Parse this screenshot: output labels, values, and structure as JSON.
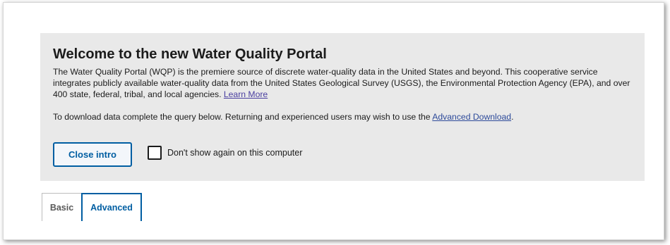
{
  "intro": {
    "title": "Welcome to the new Water Quality Portal",
    "body_text": "The Water Quality Portal (WQP) is the premiere source of discrete water-quality data in the United States and beyond. This cooperative service integrates publicly available water-quality data from the United States Geological Survey (USGS), the Environmental Protection Agency (EPA), and over 400 state, federal, tribal, and local agencies.",
    "learn_more_label": "Learn More",
    "query_text": "To download data complete the query below. Returning and experienced users may wish to use the",
    "advanced_download_label": "Advanced Download",
    "query_end": ".",
    "close_button_label": "Close intro",
    "dont_show_label": "Don't show again on this computer",
    "dont_show_checked": false
  },
  "tabs": [
    {
      "label": "Basic",
      "active": false
    },
    {
      "label": "Advanced",
      "active": true
    }
  ],
  "colors": {
    "accent": "#005ea2",
    "intro_background": "#e9e9e9",
    "link": "#2d4a9a"
  }
}
